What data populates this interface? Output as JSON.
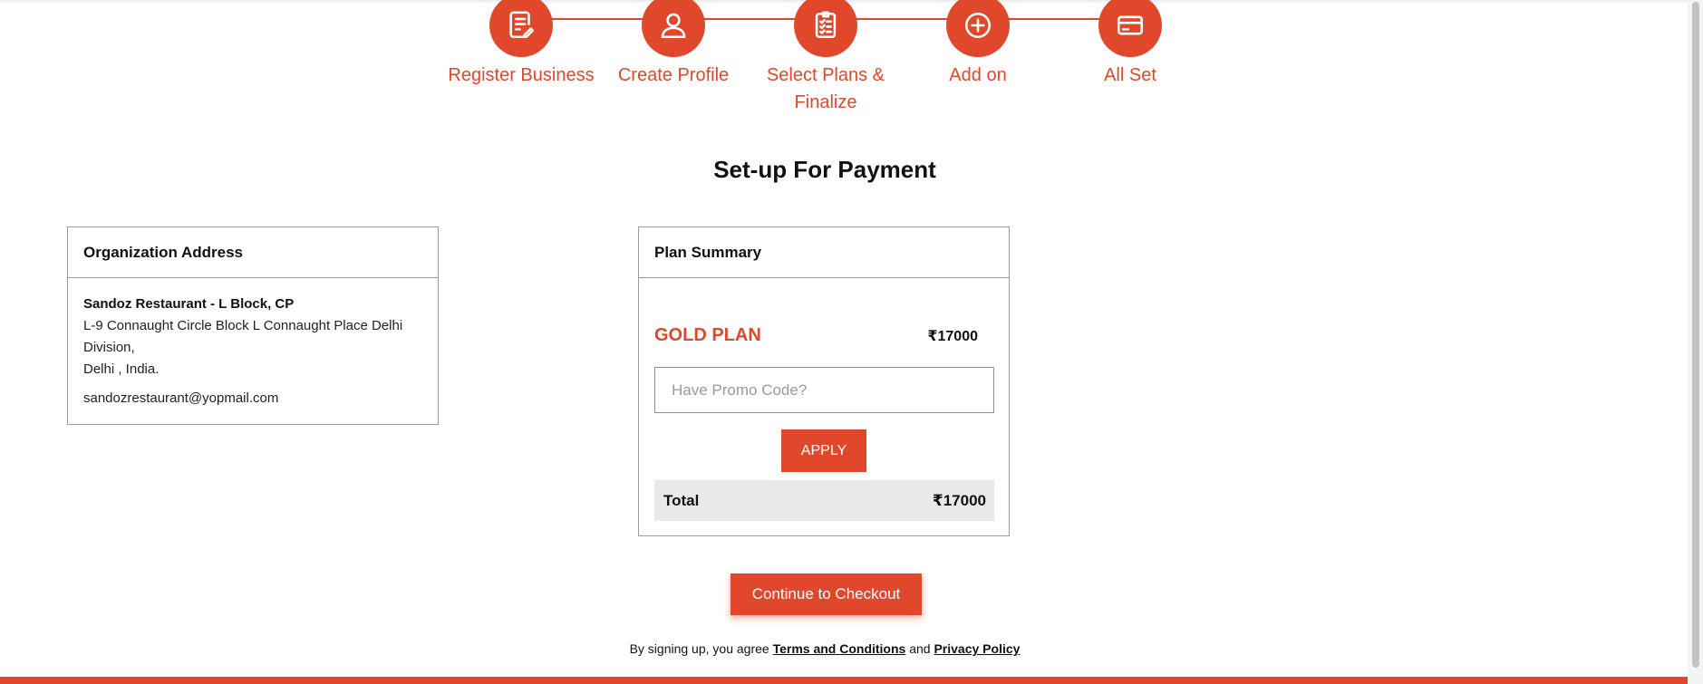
{
  "stepper": {
    "steps": [
      {
        "label": "Register Business",
        "icon": "document-edit-icon"
      },
      {
        "label": "Create Profile",
        "icon": "user-icon"
      },
      {
        "label": "Select Plans & Finalize",
        "icon": "checklist-icon"
      },
      {
        "label": "Add on",
        "icon": "plus-circle-icon"
      },
      {
        "label": "All Set",
        "icon": "credit-card-icon"
      }
    ]
  },
  "page": {
    "title": "Set-up For Payment"
  },
  "organization": {
    "heading": "Organization Address",
    "name": "Sandoz Restaurant - L Block, CP",
    "address_line1": "L-9 Connaught Circle Block L Connaught Place Delhi Division,",
    "address_line2": "Delhi , India.",
    "email": "sandozrestaurant@yopmail.com"
  },
  "plan": {
    "heading": "Plan Summary",
    "name": "GOLD PLAN",
    "price": "₹17000",
    "promo_placeholder": "Have Promo Code?",
    "promo_value": "",
    "apply_label": "APPLY",
    "total_label": "Total",
    "total_value": "₹17000"
  },
  "checkout": {
    "label": "Continue to Checkout"
  },
  "terms": {
    "prefix": "By signing up, you agree",
    "terms_link": "Terms and Conditions",
    "and": "and",
    "privacy_link": "Privacy Policy"
  },
  "colors": {
    "accent": "#e1472a",
    "total_bg": "#e9e9e9"
  }
}
